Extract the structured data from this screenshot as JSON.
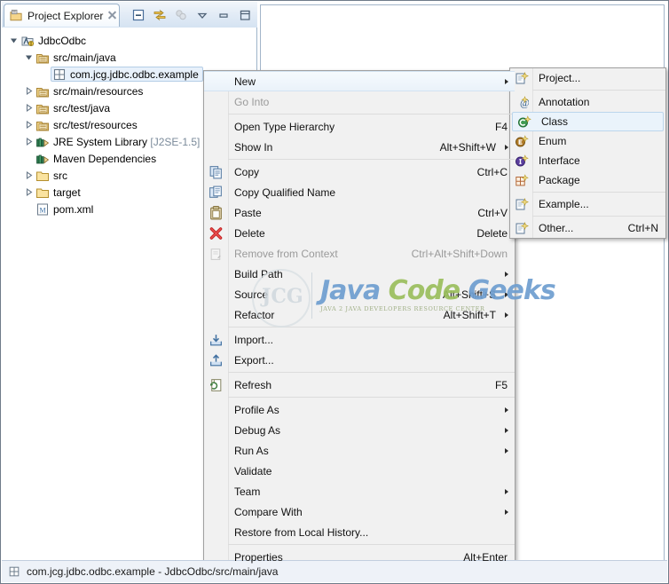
{
  "view": {
    "tab_label": "Project Explorer",
    "tab_icon": "project-explorer-icon",
    "tools": [
      {
        "name": "collapse-all-icon",
        "label": "Collapse All"
      },
      {
        "name": "link-with-editor-icon",
        "label": "Link with Editor"
      },
      {
        "name": "view-menu-icon",
        "label": "View Menu"
      },
      {
        "name": "minimize-icon",
        "label": "Minimize"
      },
      {
        "name": "maximize-icon",
        "label": "Maximize"
      }
    ]
  },
  "tree": [
    {
      "label": "JdbcOdbc",
      "indent": 0,
      "twisty": "expanded",
      "icon": "maven-project-icon",
      "selected": false,
      "dim": ""
    },
    {
      "label": "src/main/java",
      "indent": 1,
      "twisty": "expanded",
      "icon": "source-folder-icon",
      "selected": false,
      "dim": ""
    },
    {
      "label": "com.jcg.jdbc.odbc.example",
      "indent": 2,
      "twisty": "none",
      "icon": "package-icon",
      "selected": true,
      "dim": ""
    },
    {
      "label": "src/main/resources",
      "indent": 1,
      "twisty": "collapsed",
      "icon": "source-folder-icon",
      "selected": false,
      "dim": ""
    },
    {
      "label": "src/test/java",
      "indent": 1,
      "twisty": "collapsed",
      "icon": "source-folder-icon",
      "selected": false,
      "dim": ""
    },
    {
      "label": "src/test/resources",
      "indent": 1,
      "twisty": "collapsed",
      "icon": "source-folder-icon",
      "selected": false,
      "dim": ""
    },
    {
      "label": "JRE System Library ",
      "indent": 1,
      "twisty": "collapsed",
      "icon": "library-icon",
      "selected": false,
      "dim": "[J2SE-1.5]"
    },
    {
      "label": "Maven Dependencies",
      "indent": 1,
      "twisty": "none",
      "icon": "library-icon",
      "selected": false,
      "dim": ""
    },
    {
      "label": "src",
      "indent": 1,
      "twisty": "collapsed",
      "icon": "folder-icon",
      "selected": false,
      "dim": ""
    },
    {
      "label": "target",
      "indent": 1,
      "twisty": "collapsed",
      "icon": "folder-icon",
      "selected": false,
      "dim": ""
    },
    {
      "label": "pom.xml",
      "indent": 1,
      "twisty": "none",
      "icon": "maven-pom-icon",
      "selected": false,
      "dim": ""
    }
  ],
  "context_menu": [
    {
      "type": "item",
      "label": "New",
      "accel": "",
      "icon": "",
      "submenu": true,
      "disabled": false,
      "highlight": true
    },
    {
      "type": "item",
      "label": "Go Into",
      "accel": "",
      "icon": "",
      "submenu": false,
      "disabled": true,
      "highlight": false
    },
    {
      "type": "separator"
    },
    {
      "type": "item",
      "label": "Open Type Hierarchy",
      "accel": "F4",
      "icon": "",
      "submenu": false,
      "disabled": false,
      "highlight": false
    },
    {
      "type": "item",
      "label": "Show In",
      "accel": "Alt+Shift+W",
      "icon": "",
      "submenu": true,
      "disabled": false,
      "highlight": false
    },
    {
      "type": "separator"
    },
    {
      "type": "item",
      "label": "Copy",
      "accel": "Ctrl+C",
      "icon": "copy-icon",
      "submenu": false,
      "disabled": false,
      "highlight": false
    },
    {
      "type": "item",
      "label": "Copy Qualified Name",
      "accel": "",
      "icon": "copy-qualified-name-icon",
      "submenu": false,
      "disabled": false,
      "highlight": false
    },
    {
      "type": "item",
      "label": "Paste",
      "accel": "Ctrl+V",
      "icon": "paste-icon",
      "submenu": false,
      "disabled": false,
      "highlight": false
    },
    {
      "type": "item",
      "label": "Delete",
      "accel": "Delete",
      "icon": "delete-icon",
      "submenu": false,
      "disabled": false,
      "highlight": false
    },
    {
      "type": "item",
      "label": "Remove from Context",
      "accel": "Ctrl+Alt+Shift+Down",
      "icon": "remove-from-context-icon",
      "submenu": false,
      "disabled": true,
      "highlight": false
    },
    {
      "type": "item",
      "label": "Build Path",
      "accel": "",
      "icon": "",
      "submenu": true,
      "disabled": false,
      "highlight": false
    },
    {
      "type": "item",
      "label": "Source",
      "accel": "Alt+Shift+S",
      "icon": "",
      "submenu": true,
      "disabled": false,
      "highlight": false
    },
    {
      "type": "item",
      "label": "Refactor",
      "accel": "Alt+Shift+T",
      "icon": "",
      "submenu": true,
      "disabled": false,
      "highlight": false
    },
    {
      "type": "separator"
    },
    {
      "type": "item",
      "label": "Import...",
      "accel": "",
      "icon": "import-icon",
      "submenu": false,
      "disabled": false,
      "highlight": false
    },
    {
      "type": "item",
      "label": "Export...",
      "accel": "",
      "icon": "export-icon",
      "submenu": false,
      "disabled": false,
      "highlight": false
    },
    {
      "type": "separator"
    },
    {
      "type": "item",
      "label": "Refresh",
      "accel": "F5",
      "icon": "refresh-icon",
      "submenu": false,
      "disabled": false,
      "highlight": false
    },
    {
      "type": "separator"
    },
    {
      "type": "item",
      "label": "Profile As",
      "accel": "",
      "icon": "",
      "submenu": true,
      "disabled": false,
      "highlight": false
    },
    {
      "type": "item",
      "label": "Debug As",
      "accel": "",
      "icon": "",
      "submenu": true,
      "disabled": false,
      "highlight": false
    },
    {
      "type": "item",
      "label": "Run As",
      "accel": "",
      "icon": "",
      "submenu": true,
      "disabled": false,
      "highlight": false
    },
    {
      "type": "item",
      "label": "Validate",
      "accel": "",
      "icon": "",
      "submenu": false,
      "disabled": false,
      "highlight": false
    },
    {
      "type": "item",
      "label": "Team",
      "accel": "",
      "icon": "",
      "submenu": true,
      "disabled": false,
      "highlight": false
    },
    {
      "type": "item",
      "label": "Compare With",
      "accel": "",
      "icon": "",
      "submenu": true,
      "disabled": false,
      "highlight": false
    },
    {
      "type": "item",
      "label": "Restore from Local History...",
      "accel": "",
      "icon": "",
      "submenu": false,
      "disabled": false,
      "highlight": false
    },
    {
      "type": "separator"
    },
    {
      "type": "item",
      "label": "Properties",
      "accel": "Alt+Enter",
      "icon": "",
      "submenu": false,
      "disabled": false,
      "highlight": false
    }
  ],
  "new_submenu": [
    {
      "type": "item",
      "label": "Project...",
      "accel": "",
      "icon": "new-project-icon",
      "highlight": false
    },
    {
      "type": "separator"
    },
    {
      "type": "item",
      "label": "Annotation",
      "accel": "",
      "icon": "new-annotation-icon",
      "highlight": false
    },
    {
      "type": "item",
      "label": "Class",
      "accel": "",
      "icon": "new-class-icon",
      "highlight": true
    },
    {
      "type": "item",
      "label": "Enum",
      "accel": "",
      "icon": "new-enum-icon",
      "highlight": false
    },
    {
      "type": "item",
      "label": "Interface",
      "accel": "",
      "icon": "new-interface-icon",
      "highlight": false
    },
    {
      "type": "item",
      "label": "Package",
      "accel": "",
      "icon": "new-package-icon",
      "highlight": false
    },
    {
      "type": "separator"
    },
    {
      "type": "item",
      "label": "Example...",
      "accel": "",
      "icon": "new-example-icon",
      "highlight": false
    },
    {
      "type": "separator"
    },
    {
      "type": "item",
      "label": "Other...",
      "accel": "Ctrl+N",
      "icon": "new-other-icon",
      "highlight": false
    }
  ],
  "statusbar": {
    "icon": "package-icon",
    "text": "com.jcg.jdbc.odbc.example - JdbcOdbc/src/main/java"
  },
  "watermark": {
    "word1": "Java",
    "word2": "Code",
    "word3": "Geeks",
    "tagline": "JAVA 2 JAVA DEVELOPERS RESOURCE CENTER",
    "monogram": "JCG",
    "color1": "#6f9fd0",
    "color2": "#9bbf5e",
    "color3": "#6f9fd0"
  },
  "colors": {
    "menu_bg": "#f1f1f1",
    "selection": "#e8f1fb",
    "tab_gradient_top": "#f2f6fb",
    "dim_text": "#7a8a9a"
  }
}
